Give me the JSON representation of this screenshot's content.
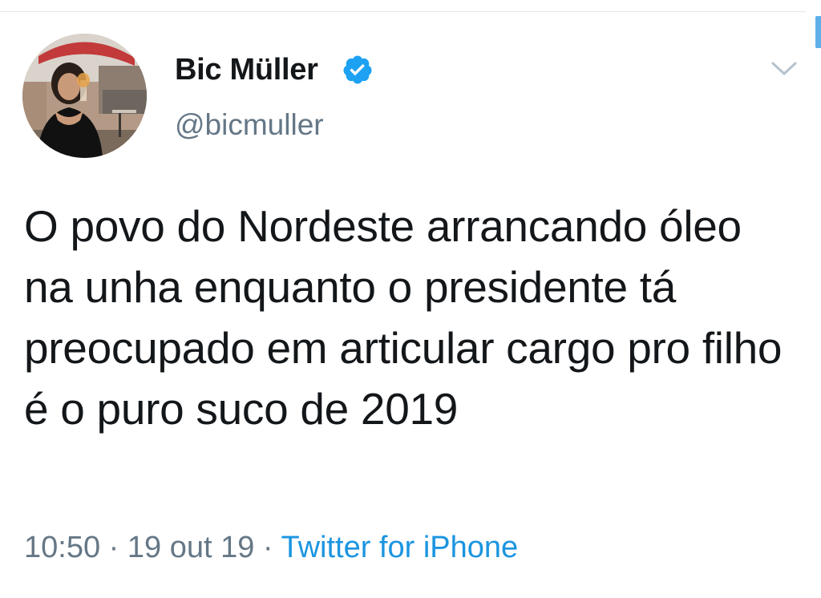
{
  "tweet": {
    "author": {
      "display_name": "Bic Müller",
      "handle": "@bicmuller",
      "verified": true,
      "avatar_icon": "profile-photo"
    },
    "text": "O povo do Nordeste arrancando óleo na unha enquanto o presidente tá preocupado em articular cargo pro filho é o puro suco de 2019",
    "meta": {
      "time": "10:50",
      "separator": " · ",
      "date": "19 out 19",
      "source": "Twitter for iPhone"
    },
    "menu_icon": "chevron-down-icon"
  },
  "colors": {
    "text_primary": "#14171a",
    "text_secondary": "#657786",
    "link": "#1b95e0",
    "verified": "#1da1f2"
  }
}
